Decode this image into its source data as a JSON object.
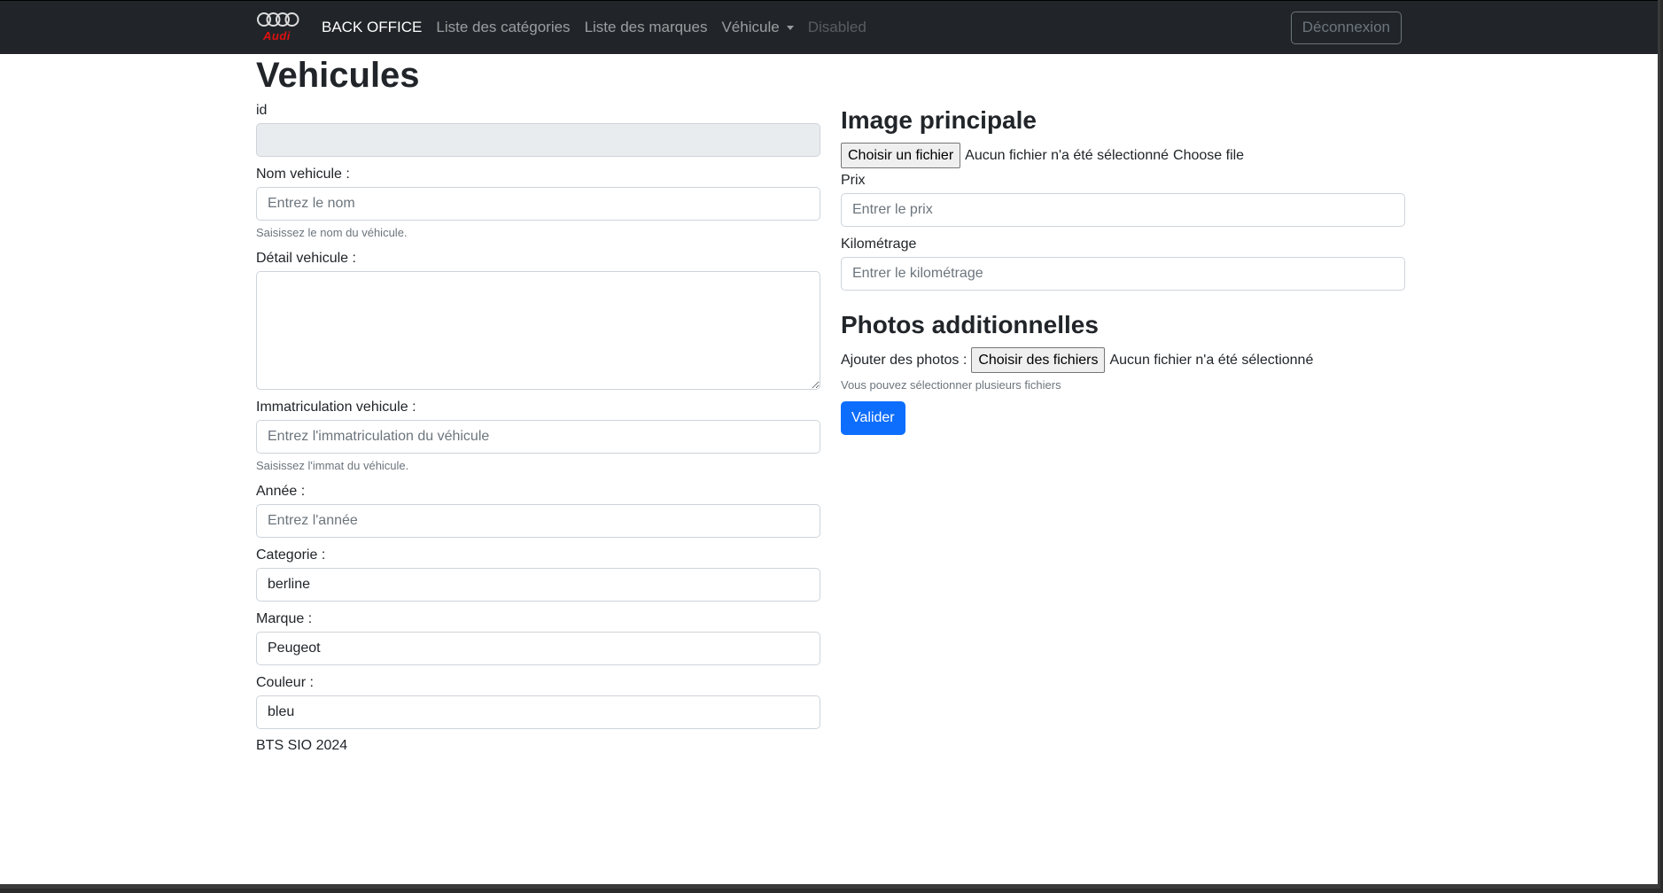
{
  "nav": {
    "logo_text": "Audi",
    "brand": "BACK OFFICE",
    "links": [
      "Liste des catégories",
      "Liste des marques"
    ],
    "dropdown": "Véhicule",
    "disabled": "Disabled",
    "logout": "Déconnexion"
  },
  "page": {
    "title": "Vehicules"
  },
  "form": {
    "id": {
      "label": "id",
      "value": ""
    },
    "nom": {
      "label": "Nom vehicule :",
      "placeholder": "Entrez le nom",
      "help": "Saisissez le nom du véhicule."
    },
    "detail": {
      "label": "Détail vehicule :"
    },
    "immat": {
      "label": "Immatriculation vehicule :",
      "placeholder": "Entrez l'immatriculation du véhicule",
      "help": "Saisissez l'immat du véhicule."
    },
    "annee": {
      "label": "Année :",
      "placeholder": "Entrez l'année"
    },
    "categorie": {
      "label": "Categorie :",
      "value": "berline"
    },
    "marque": {
      "label": "Marque :",
      "value": "Peugeot"
    },
    "couleur": {
      "label": "Couleur :",
      "value": "bleu"
    }
  },
  "right": {
    "image_title": "Image principale",
    "file_button": "Choisir un fichier",
    "file_status": "Aucun fichier n'a été sélectionné",
    "file_suffix": "Choose file",
    "prix": {
      "label": "Prix",
      "placeholder": "Entrer le prix"
    },
    "km": {
      "label": "Kilométrage",
      "placeholder": "Entrer le kilométrage"
    },
    "photos_title": "Photos additionnelles",
    "photos_label": "Ajouter des photos :",
    "photos_button": "Choisir des fichiers",
    "photos_status": "Aucun fichier n'a été sélectionné",
    "photos_help": "Vous pouvez sélectionner plusieurs fichiers",
    "submit": "Valider"
  },
  "footer": "BTS SIO 2024",
  "colors": {
    "navbar": "#212529",
    "primary": "#0d6efd",
    "logo_red": "#e01010"
  }
}
